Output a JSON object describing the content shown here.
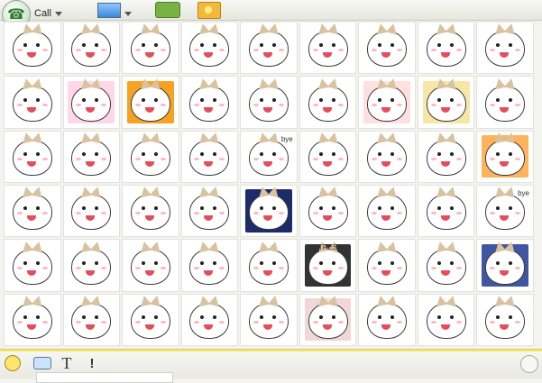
{
  "toolbar": {
    "call_label": "Call",
    "buttons": [
      {
        "name": "call",
        "icon": "phone-icon"
      },
      {
        "name": "share-screen",
        "icon": "monitor-icon"
      },
      {
        "name": "apps",
        "icon": "puzzle-icon"
      },
      {
        "name": "photos",
        "icon": "photo-icon"
      }
    ]
  },
  "emoticons": {
    "rows": 6,
    "cols": 9,
    "cells": [
      {
        "cap": ""
      },
      {
        "cap": ""
      },
      {
        "cap": ""
      },
      {
        "cap": ""
      },
      {
        "cap": ""
      },
      {
        "cap": ""
      },
      {
        "cap": ""
      },
      {
        "cap": ""
      },
      {
        "cap": ""
      },
      {
        "cap": "",
        "bg": "#ffffff"
      },
      {
        "cap": "",
        "bg": "#ffd7e6"
      },
      {
        "cap": "",
        "bg": "#f7a321"
      },
      {
        "cap": ""
      },
      {
        "cap": ""
      },
      {
        "cap": ""
      },
      {
        "cap": "",
        "bg": "#ffe0e0"
      },
      {
        "cap": "",
        "bg": "#f6e7a7"
      },
      {
        "cap": ""
      },
      {
        "cap": ""
      },
      {
        "cap": ""
      },
      {
        "cap": ""
      },
      {
        "cap": ""
      },
      {
        "cap": "bye"
      },
      {
        "cap": ""
      },
      {
        "cap": ""
      },
      {
        "cap": ""
      },
      {
        "cap": "",
        "bg": "#ffb35a"
      },
      {
        "cap": ""
      },
      {
        "cap": ""
      },
      {
        "cap": ""
      },
      {
        "cap": ""
      },
      {
        "cap": "",
        "bg": "#1d2b6a"
      },
      {
        "cap": ""
      },
      {
        "cap": ""
      },
      {
        "cap": ""
      },
      {
        "cap": "bye"
      },
      {
        "cap": ""
      },
      {
        "cap": ""
      },
      {
        "cap": ""
      },
      {
        "cap": ""
      },
      {
        "cap": ""
      },
      {
        "cap": "STRESS",
        "bg": "#333333"
      },
      {
        "cap": ""
      },
      {
        "cap": ""
      },
      {
        "cap": "",
        "bg": "#3f57a3"
      },
      {
        "cap": ""
      },
      {
        "cap": ""
      },
      {
        "cap": ""
      },
      {
        "cap": ""
      },
      {
        "cap": ""
      },
      {
        "cap": "",
        "bg": "#f1d7d7"
      },
      {
        "cap": ""
      },
      {
        "cap": ""
      },
      {
        "cap": ""
      }
    ]
  },
  "bottombar": {
    "font_label": "T",
    "nudge_label": "!",
    "icons": [
      "smile-icon",
      "wink-icon",
      "font-icon",
      "nudge-icon"
    ]
  }
}
